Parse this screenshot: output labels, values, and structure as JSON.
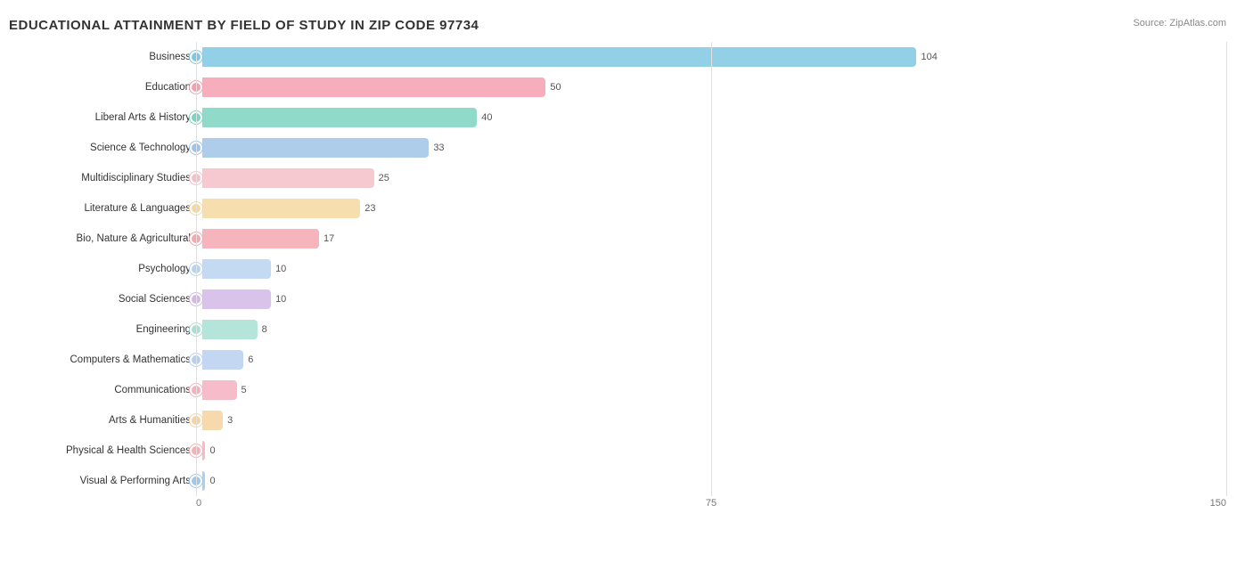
{
  "title": "EDUCATIONAL ATTAINMENT BY FIELD OF STUDY IN ZIP CODE 97734",
  "source": "Source: ZipAtlas.com",
  "max_value": 150,
  "grid_values": [
    0,
    75,
    150
  ],
  "bars": [
    {
      "label": "Business",
      "value": 104,
      "color": "#7ec8e3",
      "dot_color": "#d44"
    },
    {
      "label": "Education",
      "value": 50,
      "color": "#f5a0b0",
      "dot_color": "#d44"
    },
    {
      "label": "Liberal Arts & History",
      "value": 40,
      "color": "#7dd4c0",
      "dot_color": "#d44"
    },
    {
      "label": "Science & Technology",
      "value": 33,
      "color": "#a0c4e8",
      "dot_color": "#d44"
    },
    {
      "label": "Multidisciplinary Studies",
      "value": 25,
      "color": "#f5c0c8",
      "dot_color": "#d44"
    },
    {
      "label": "Literature & Languages",
      "value": 23,
      "color": "#f5d8a0",
      "dot_color": "#d44"
    },
    {
      "label": "Bio, Nature & Agricultural",
      "value": 17,
      "color": "#f5a8b0",
      "dot_color": "#d44"
    },
    {
      "label": "Psychology",
      "value": 10,
      "color": "#b8d4f0",
      "dot_color": "#d44"
    },
    {
      "label": "Social Sciences",
      "value": 10,
      "color": "#d4b8e8",
      "dot_color": "#d44"
    },
    {
      "label": "Engineering",
      "value": 8,
      "color": "#a8e0d4",
      "dot_color": "#d44"
    },
    {
      "label": "Computers & Mathematics",
      "value": 6,
      "color": "#b8d0f0",
      "dot_color": "#d44"
    },
    {
      "label": "Communications",
      "value": 5,
      "color": "#f5b0c0",
      "dot_color": "#d44"
    },
    {
      "label": "Arts & Humanities",
      "value": 3,
      "color": "#f5d4a0",
      "dot_color": "#d44"
    },
    {
      "label": "Physical & Health Sciences",
      "value": 0,
      "color": "#f5b0b8",
      "dot_color": "#d44"
    },
    {
      "label": "Visual & Performing Arts",
      "value": 0,
      "color": "#a0c8e8",
      "dot_color": "#d44"
    }
  ]
}
